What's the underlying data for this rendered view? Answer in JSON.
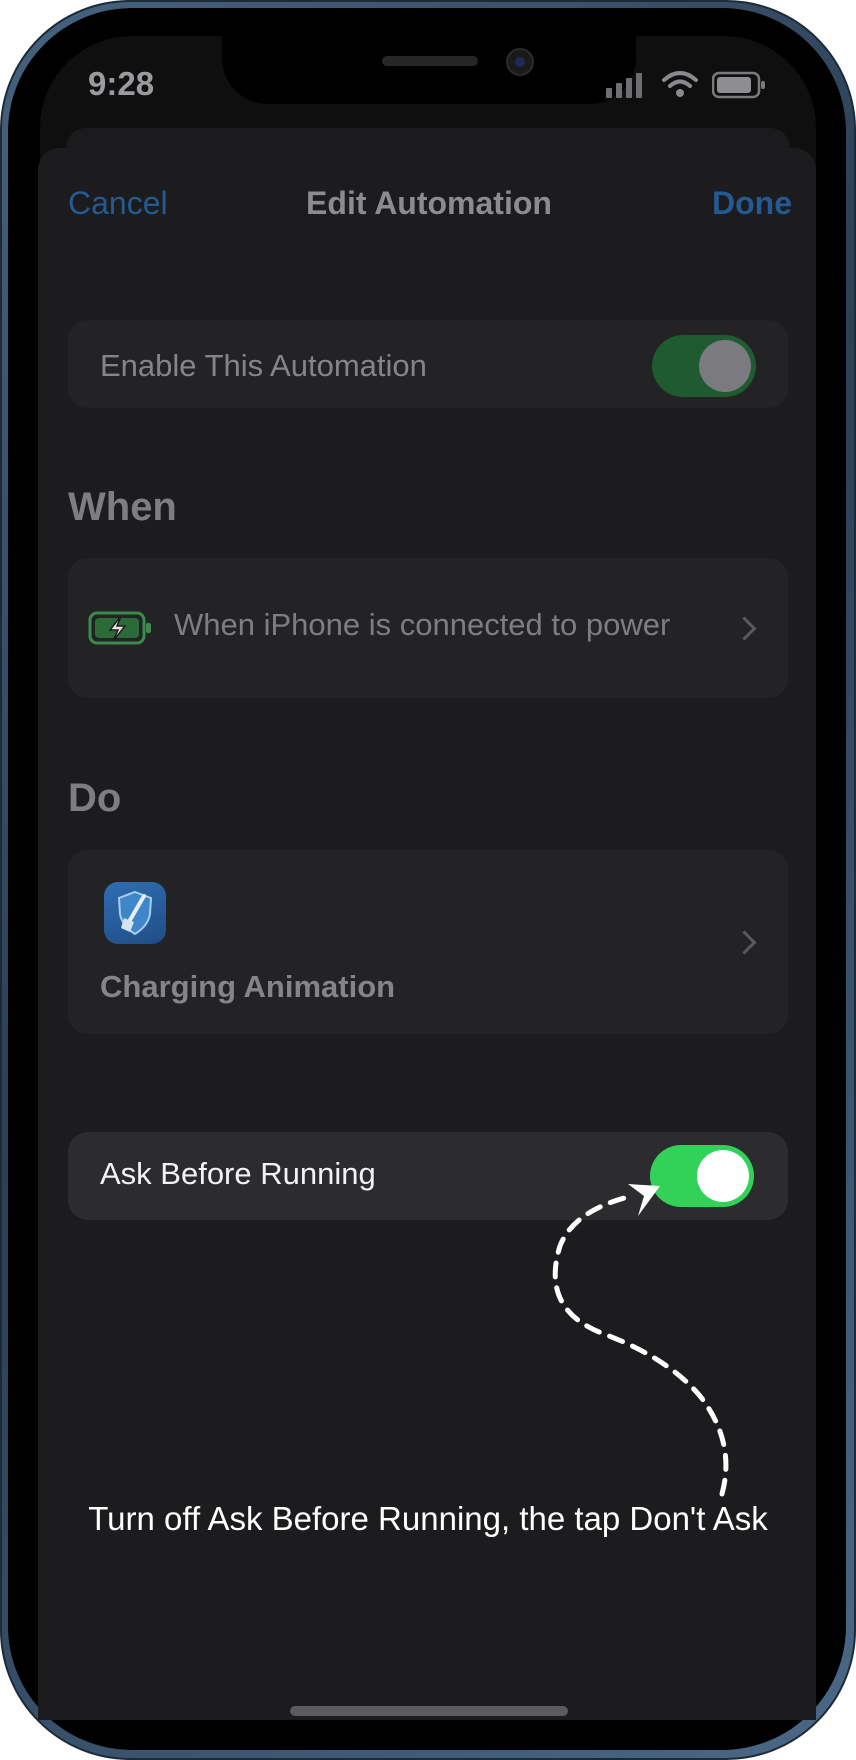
{
  "status_bar": {
    "time": "9:28",
    "icons": [
      "cellular-signal-icon",
      "wifi-icon",
      "battery-icon"
    ]
  },
  "nav": {
    "cancel_label": "Cancel",
    "title": "Edit Automation",
    "done_label": "Done"
  },
  "enable": {
    "label": "Enable This Automation",
    "toggle_on": true
  },
  "when": {
    "heading": "When",
    "trigger_label": "When iPhone is connected to power",
    "icon": "charging-battery-icon"
  },
  "do": {
    "heading": "Do",
    "action_label": "Charging Animation",
    "icon": "shield-broom-app-icon"
  },
  "ask_before_running": {
    "label": "Ask Before Running",
    "toggle_on": true
  },
  "annotation": {
    "text": "Turn off Ask Before Running, the tap Don't Ask"
  },
  "colors": {
    "accent_blue": "#245a91",
    "toggle_green": "#32d158",
    "sheet_bg": "#1c1c1e"
  }
}
